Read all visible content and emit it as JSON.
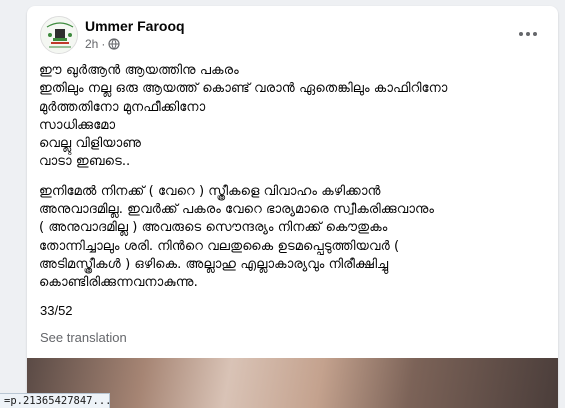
{
  "post": {
    "author": "Ummer Farooq",
    "time": "2h",
    "separator": "·",
    "paragraph1": "ഈ ഖുർആൻ ആയത്തിനു പകരം\nഇതിലും നല്ല ഒരു ആയത്ത് കൊണ്ട് വരാൻ ഏതെങ്കിലും കാഫിറിനോ\nമുർത്തതിനോ മുനഫീക്കിനോ\nസാധിക്കുമോ\nവെല്ലു വിളിയാണു\nവാടാ ഇബടെ..",
    "paragraph2": "ഇനിമേല്‍ നിനക്ക് ( വേറെ ) സ്ത്രീകളെ വിവാഹം കഴിക്കാന്‍\nഅനുവാദമില്ല. ഇവര്‍ക്ക് പകരം വേറെ ഭാര്യമാരെ സ്വീകരിക്കുവാനും\n( അനുവാദമില്ല ) അവരുടെ സൌന്ദര്യം നിനക്ക് കൌതുകം\nതോന്നിച്ചാലും ശരി. നിന്‍റെ വലതുകൈ ഉടമപ്പെടുത്തിയവര്‍ (\nഅടിമസ്ത്രീകള്‍ ) ഒഴികെ. അല്ലാഹു എല്ലാകാര്യവും നിരീക്ഷിച്ചു\nകൊണ്ടിരിക്കുന്നവനാകുന്നു.",
    "verse_ref": "33/52",
    "see_translation": "See translation"
  },
  "icons": {
    "privacy": "globe-icon",
    "more": "more-options-icon"
  },
  "status_url": "=p.21365427847..."
}
